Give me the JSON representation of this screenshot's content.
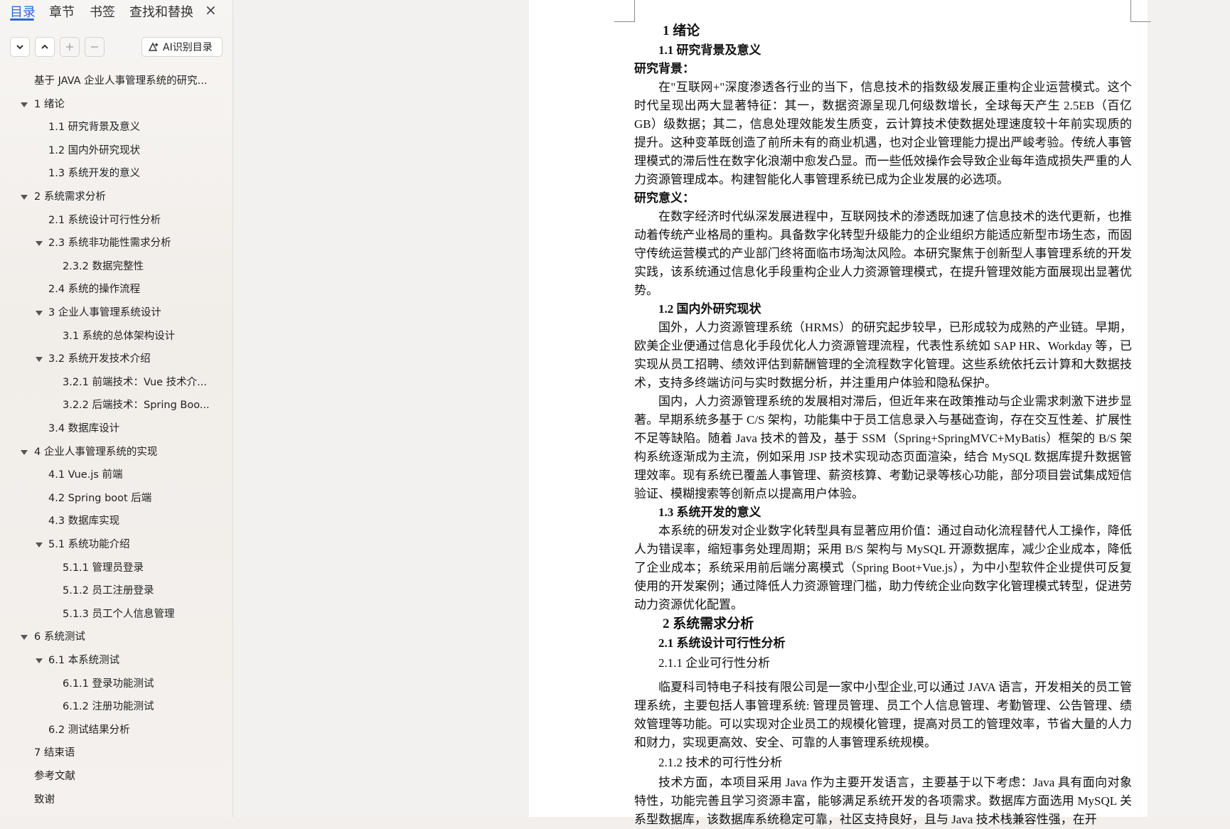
{
  "nav": {
    "tabs": [
      "目录",
      "章节",
      "书签",
      "查找和替换"
    ],
    "active_tab": "目录",
    "close_label": "×",
    "toolbar": {
      "expand_icon": "chevron-down-icon",
      "collapse_icon": "chevron-up-icon",
      "add_icon": "plus-icon",
      "remove_icon": "minus-icon",
      "ai_label": "AI识别目录"
    },
    "outline": [
      {
        "label": "基于 JAVA 企业人事管理系统的研究...",
        "level": 0,
        "caret": false
      },
      {
        "label": "1  绪论",
        "level": 0,
        "caret": true
      },
      {
        "label": "1.1  研究背景及意义",
        "level": 1,
        "caret": false
      },
      {
        "label": "1.2 国内外研究现状",
        "level": 1,
        "caret": false
      },
      {
        "label": "1.3  系统开发的意义",
        "level": 1,
        "caret": false
      },
      {
        "label": "2  系统需求分析",
        "level": 0,
        "caret": true
      },
      {
        "label": "2.1  系统设计可行性分析",
        "level": 1,
        "caret": false
      },
      {
        "label": "2.3  系统非功能性需求分析",
        "level": 1,
        "caret": true
      },
      {
        "label": "2.3.2  数据完整性",
        "level": 2,
        "caret": false
      },
      {
        "label": "2.4  系统的操作流程",
        "level": 1,
        "caret": false
      },
      {
        "label": "3  企业人事管理系统设计",
        "level": 1,
        "caret": true
      },
      {
        "label": "3.1  系统的总体架构设计",
        "level": 2,
        "caret": false
      },
      {
        "label": "3.2  系统开发技术介绍",
        "level": 1,
        "caret": true
      },
      {
        "label": "3.2.1  前端技术：Vue 技术介...",
        "level": 2,
        "caret": false
      },
      {
        "label": "3.2.2  后端技术：Spring Boo...",
        "level": 2,
        "caret": false
      },
      {
        "label": "3.4  数据库设计",
        "level": 1,
        "caret": false
      },
      {
        "label": "4  企业人事管理系统的实现",
        "level": 0,
        "caret": true
      },
      {
        "label": "4.1 Vue.js 前端",
        "level": 1,
        "caret": false
      },
      {
        "label": "4.2 Spring boot 后端",
        "level": 1,
        "caret": false
      },
      {
        "label": "4.3  数据库实现",
        "level": 1,
        "caret": false
      },
      {
        "label": "5.1 系统功能介绍",
        "level": 1,
        "caret": true
      },
      {
        "label": "5.1.1 管理员登录",
        "level": 2,
        "caret": false
      },
      {
        "label": "5.1.2  员工注册登录",
        "level": 2,
        "caret": false
      },
      {
        "label": "5.1.3  员工个人信息管理",
        "level": 2,
        "caret": false
      },
      {
        "label": "6 系统测试",
        "level": 0,
        "caret": true
      },
      {
        "label": "6.1  本系统测试",
        "level": 1,
        "caret": true
      },
      {
        "label": "6.1.1  登录功能测试",
        "level": 2,
        "caret": false
      },
      {
        "label": "6.1.2  注册功能测试",
        "level": 2,
        "caret": false
      },
      {
        "label": "6.2 测试结果分析",
        "level": 1,
        "caret": false
      },
      {
        "label": "7  结束语",
        "level": 0,
        "caret": false
      },
      {
        "label": "参考文献",
        "level": 0,
        "caret": false
      },
      {
        "label": "致谢",
        "level": 0,
        "caret": false
      }
    ]
  },
  "document": {
    "blocks": [
      {
        "type": "h1",
        "text": "1  绪论"
      },
      {
        "type": "h2",
        "text": "1.1  研究背景及意义"
      },
      {
        "type": "lead",
        "text": "研究背景："
      },
      {
        "type": "para",
        "text": "在\"互联网+\"深度渗透各行业的当下，信息技术的指数级发展正重构企业运营模式。这个时代呈现出两大显著特征：其一，数据资源呈现几何级数增长，全球每天产生 2.5EB（百亿 GB）级数据；其二，信息处理效能发生质变，云计算技术使数据处理速度较十年前实现质的提升。这种变革既创造了前所未有的商业机遇，也对企业管理能力提出严峻考验。传统人事管理模式的滞后性在数字化浪潮中愈发凸显。而一些低效操作会导致企业每年造成损失严重的人力资源管理成本。构建智能化人事管理系统已成为企业发展的必选项。"
      },
      {
        "type": "lead",
        "text": "研究意义："
      },
      {
        "type": "para",
        "text": "在数字经济时代纵深发展进程中，互联网技术的渗透既加速了信息技术的迭代更新，也推动着传统产业格局的重构。具备数字化转型升级能力的企业组织方能适应新型市场生态，而固守传统运营模式的产业部门终将面临市场淘汰风险。本研究聚焦于创新型人事管理系统的开发实践，该系统通过信息化手段重构企业人力资源管理模式，在提升管理效能方面展现出显著优势。"
      },
      {
        "type": "h2",
        "text": "1.2 国内外研究现状"
      },
      {
        "type": "para",
        "text": "国外，人力资源管理系统（HRMS）的研究起步较早，已形成较为成熟的产业链。早期，欧美企业便通过信息化手段优化人力资源管理流程，代表性系统如 SAP HR、Workday 等，已实现从员工招聘、绩效评估到薪酬管理的全流程数字化管理。这些系统依托云计算和大数据技术，支持多终端访问与实时数据分析，并注重用户体验和隐私保护。"
      },
      {
        "type": "para",
        "text": "国内，人力资源管理系统的发展相对滞后，但近年来在政策推动与企业需求刺激下进步显著。早期系统多基于 C/S 架构，功能集中于员工信息录入与基础查询，存在交互性差、扩展性不足等缺陷。随着 Java 技术的普及，基于 SSM（Spring+SpringMVC+MyBatis）框架的 B/S 架构系统逐渐成为主流，例如采用 JSP 技术实现动态页面渲染，结合 MySQL 数据库提升数据管理效率。现有系统已覆盖人事管理、薪资核算、考勤记录等核心功能，部分项目尝试集成短信验证、模糊搜索等创新点以提高用户体验。"
      },
      {
        "type": "h2",
        "text": "1.3  系统开发的意义"
      },
      {
        "type": "para",
        "text": "本系统的研发对企业数字化转型具有显著应用价值：通过自动化流程替代人工操作，降低人为错误率，缩短事务处理周期；采用 B/S 架构与 MySQL 开源数据库，减少企业成本，降低了企业成本；系统采用前后端分离模式（Spring Boot+Vue.js），为中小型软件企业提供可反复使用的开发案例；通过降低人力资源管理门槛，助力传统企业向数字化管理模式转型，促进劳动力资源优化配置。"
      },
      {
        "type": "h1",
        "text": "2  系统需求分析"
      },
      {
        "type": "h2",
        "text": "2.1  系统设计可行性分析"
      },
      {
        "type": "h3",
        "text": "2.1.1 企业可行性分析"
      },
      {
        "type": "para",
        "text": "临夏科司特电子科技有限公司是一家中小型企业,可以通过 JAVA 语言，开发相关的员工管理系统，主要包括人事管理系统: 管理员管理、员工个人信息管理、考勤管理、公告管理、绩效管理等功能。可以实现对企业员工的规模化管理，提高对员工的管理效率，节省大量的人力和财力，实现更高效、安全、可靠的人事管理系统规模。",
        "gap": true
      },
      {
        "type": "h3",
        "text": "2.1.2  技术的可行性分析"
      },
      {
        "type": "para",
        "text": "技术方面，本项目采用 Java 作为主要开发语言，主要基于以下考虑：Java 具有面向对象特性，功能完善且学习资源丰富，能够满足系统开发的各项需求。数据库方面选用 MySQL 关系型数据库，该数据库系统稳定可靠，社区支持良好，且与 Java 技术栈兼容性强，在开"
      }
    ]
  }
}
